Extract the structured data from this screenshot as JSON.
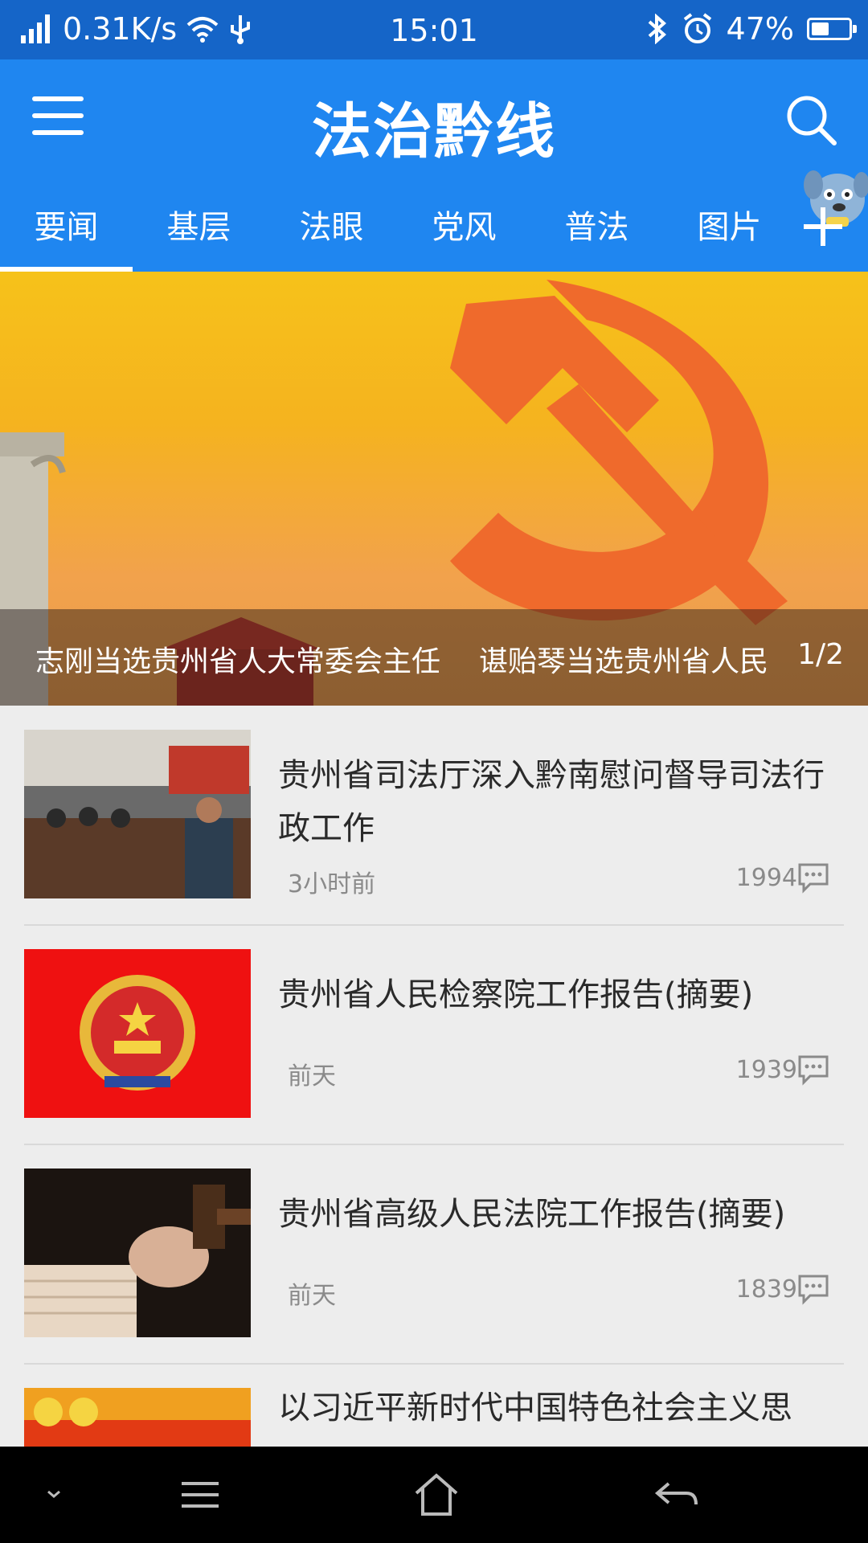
{
  "status_bar": {
    "net_speed": "0.31K/s",
    "time": "15:01",
    "battery": "47%",
    "battery_level": 0.47
  },
  "header": {
    "title": "法治黔线",
    "menu_icon": "menu-icon",
    "search_icon": "search-icon"
  },
  "tabs": [
    {
      "label": "要闻",
      "active": true
    },
    {
      "label": "基层"
    },
    {
      "label": "法眼"
    },
    {
      "label": "党风"
    },
    {
      "label": "普法"
    },
    {
      "label": "图片"
    }
  ],
  "banner": {
    "caption_1": "志刚当选贵州省人大常委会主任",
    "caption_2": "谌贻琴当选贵州省人民",
    "page": "1/2"
  },
  "news": [
    {
      "title": "贵州省司法厅深入黔南慰问督导司法行政工作",
      "time": "3小时前",
      "comments": "1994"
    },
    {
      "title": "贵州省人民检察院工作报告(摘要)",
      "time": "前天",
      "comments": "1939"
    },
    {
      "title": "贵州省高级人民法院工作报告(摘要)",
      "time": "前天",
      "comments": "1839"
    },
    {
      "title": "以习近平新时代中国特色社会主义思"
    }
  ],
  "colors": {
    "status_bar": "#1565c8",
    "app_bar": "#1f86f0",
    "background": "#ededed",
    "nav_bar": "#000000"
  }
}
